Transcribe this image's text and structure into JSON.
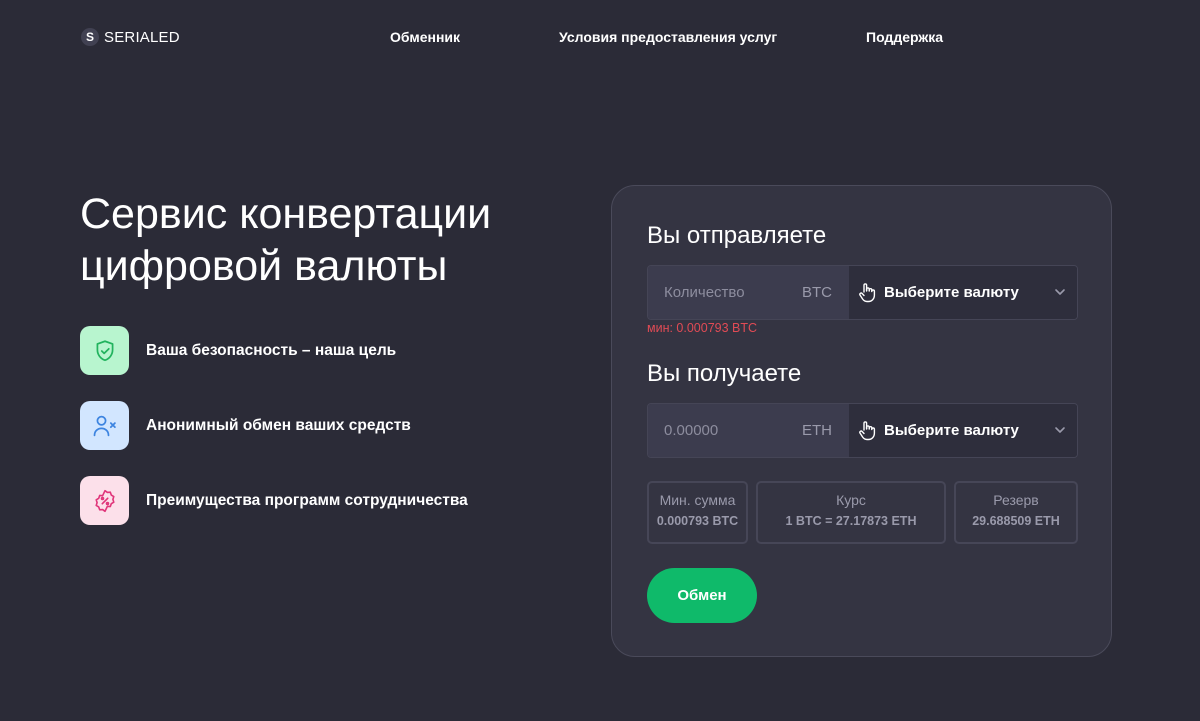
{
  "brand": {
    "logo_letter": "S",
    "name": "SERIALED"
  },
  "nav": {
    "exchanger": "Обменник",
    "terms": "Условия предоставления услуг",
    "support": "Поддержка"
  },
  "hero": {
    "title_line1": "Сервис конвертации",
    "title_line2": "цифровой валюты"
  },
  "features": [
    {
      "icon": "shield-check-icon",
      "text": "Ваша безопасность – наша цель"
    },
    {
      "icon": "user-x-icon",
      "text": "Анонимный обмен ваших средств"
    },
    {
      "icon": "percent-badge-icon",
      "text": "Преимущества программ сотрудничества"
    }
  ],
  "exchange": {
    "send": {
      "title": "Вы отправляете",
      "placeholder": "Количество",
      "unit": "BTC",
      "select_label": "Выберите валюту",
      "min_note": "мин: 0.000793 BTC"
    },
    "receive": {
      "title": "Вы получаете",
      "placeholder": "0.00000",
      "unit": "ETH",
      "select_label": "Выберите валюту"
    },
    "info": {
      "min": {
        "label": "Мин. сумма",
        "value": "0.000793 BTC"
      },
      "rate": {
        "label": "Курс",
        "value": "1 BTC = 27.17873 ETH"
      },
      "reserve": {
        "label": "Резерв",
        "value": "29.688509 ETH"
      }
    },
    "button_label": "Обмен"
  },
  "colors": {
    "background": "#2b2b37",
    "card": "#343442",
    "accent_green": "#0fba6a",
    "error_red": "#e14b55",
    "feature_security_bg": "#b8f5cf",
    "feature_anon_bg": "#d2e6ff",
    "feature_partner_bg": "#fce0ea"
  }
}
